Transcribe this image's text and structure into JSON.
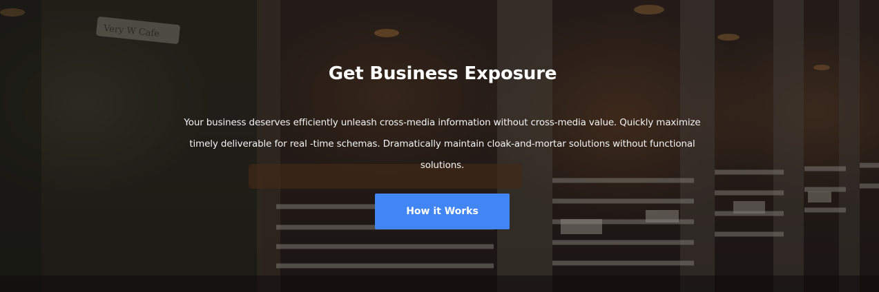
{
  "hero": {
    "title": "Get Business Exposure",
    "description": "Your business deserves efficiently unleash cross-media information without cross-media value. Quickly maximize timely deliverable for real -time schemas. Dramatically maintain cloak-and-mortar solutions without functional solutions.",
    "button_label": "How it Works",
    "background_image_sign": "Very W  Cafe"
  },
  "colors": {
    "button": "#4285f4",
    "text": "#ffffff",
    "overlay": "rgba(0,0,0,0.38)"
  }
}
